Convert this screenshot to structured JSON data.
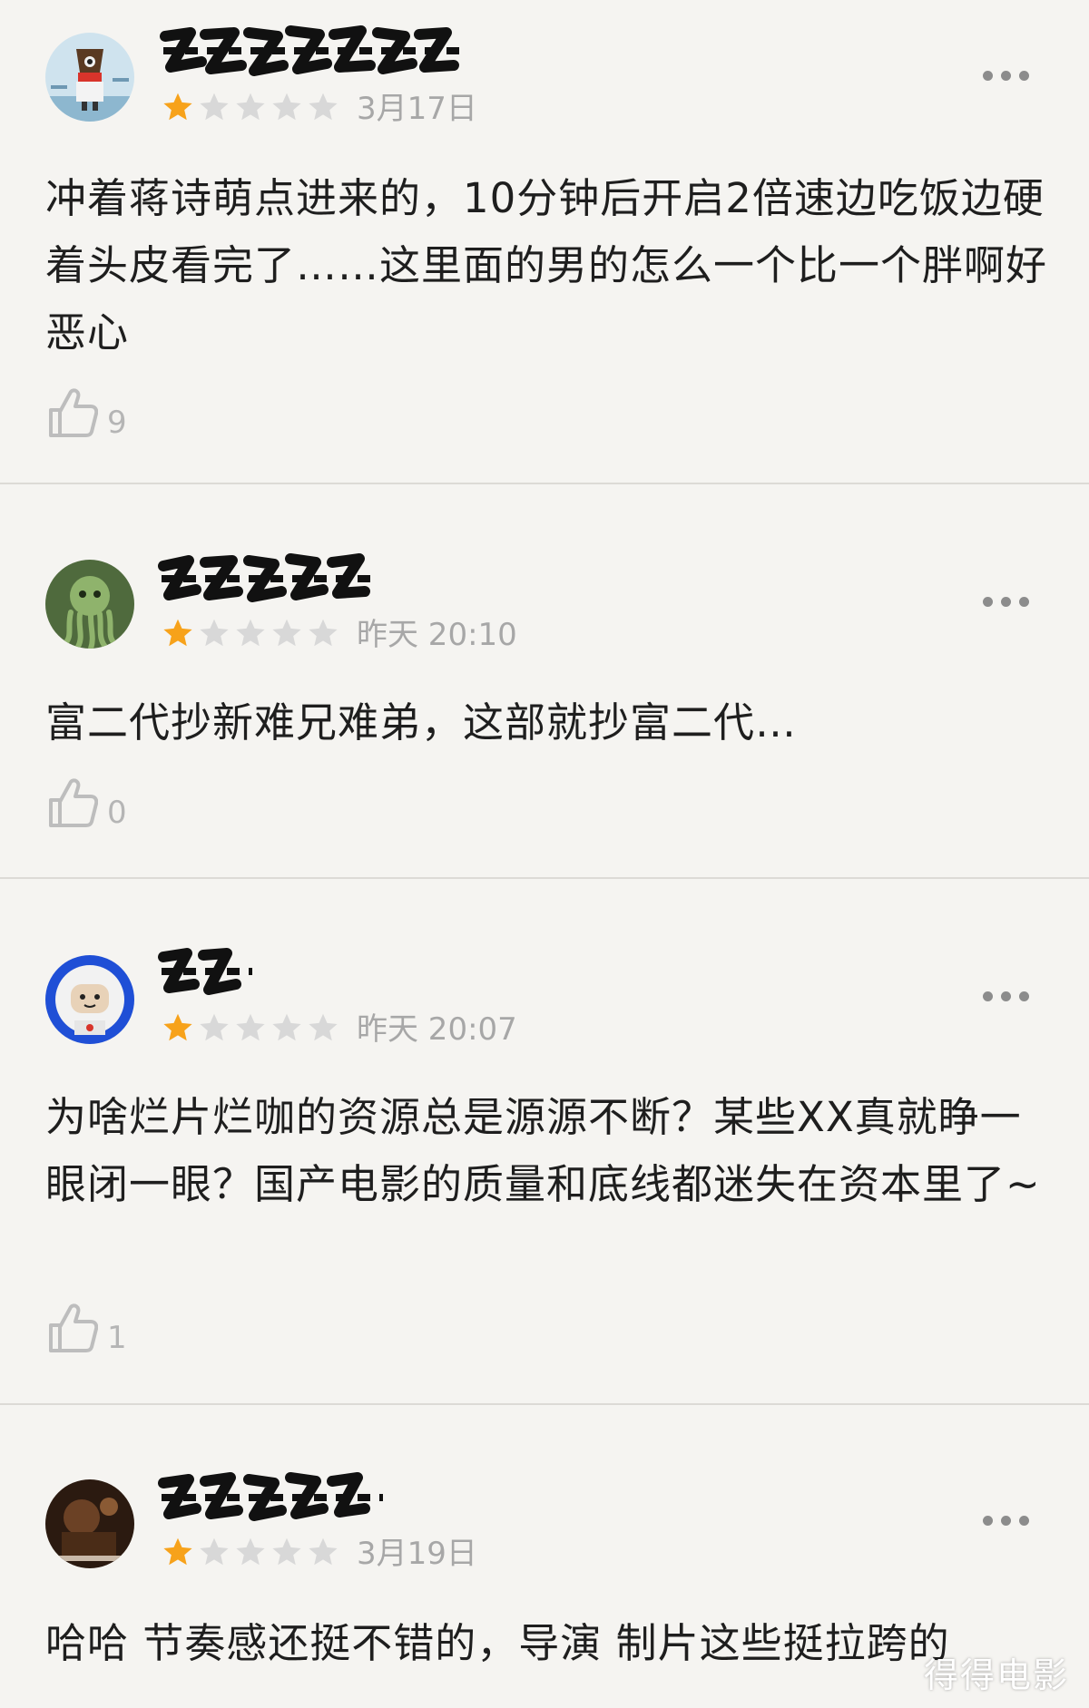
{
  "reviews": [
    {
      "avatar": "avatar-cartoon-red-scarf",
      "rating": 1,
      "time": "3月17日",
      "content": "冲着蒋诗萌点进来的，10分钟后开启2倍速边吃饭边硬着头皮看完了……这里面的男的怎么一个比一个胖啊好恶心",
      "likes": "9"
    },
    {
      "avatar": "avatar-green-octopus",
      "rating": 1,
      "time": "昨天 20:10",
      "content": "富二代抄新难兄难弟，这部就抄富二代…",
      "likes": "0"
    },
    {
      "avatar": "avatar-astronaut",
      "rating": 1,
      "time": "昨天 20:07",
      "content": "为啥烂片烂咖的资源总是源源不断？某些XX真就睁一眼闭一眼？国产电影的质量和底线都迷失在资本里了~",
      "likes": "1"
    },
    {
      "avatar": "avatar-dark-photo",
      "rating": 1,
      "time": "3月19日",
      "content": "哈哈 节奏感还挺不错的，导演 制片这些挺拉跨的",
      "likes": ""
    }
  ],
  "watermark": "得得电影",
  "colors": {
    "star_filled": "#f7a21a",
    "star_empty": "#d8d8d8",
    "text": "#1e1e1e",
    "muted": "#a7a7a7",
    "background": "#f5f4f1"
  }
}
